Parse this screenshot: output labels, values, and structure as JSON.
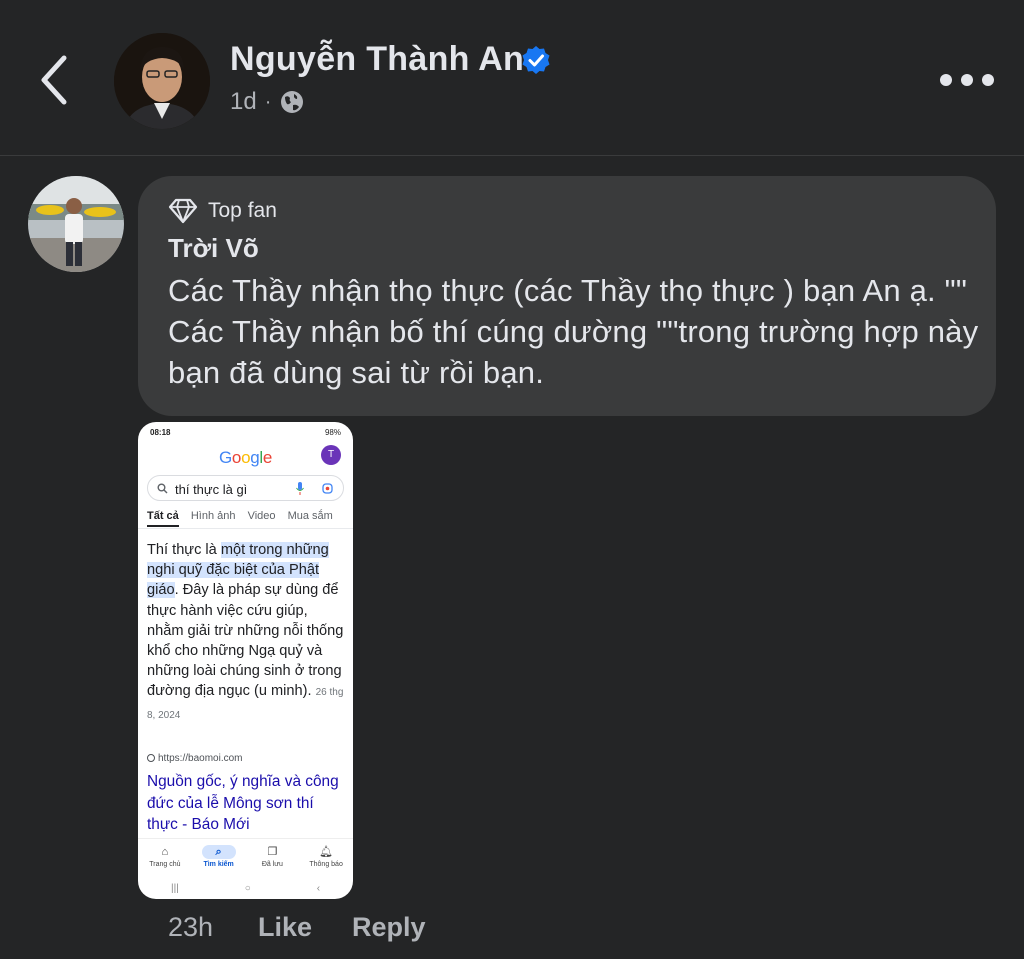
{
  "header": {
    "author_name": "Nguyễn Thành An",
    "time": "1d",
    "separator": "·",
    "verified": true,
    "privacy_icon": "globe-icon",
    "back_icon": "chevron-left-icon",
    "more_icon": "more-horizontal-icon"
  },
  "comment": {
    "badge_icon": "diamond-icon",
    "badge_label": "Top fan",
    "commenter_name": "Trời Võ",
    "text": "Các Thầy nhận thọ thực (các Thầy thọ thực ) bạn An ạ. \"\" Các Thầy nhận bố thí cúng dường \"\"trong trường hợp này bạn đã dùng sai từ rồi bạn.",
    "time": "23h",
    "like_label": "Like",
    "reply_label": "Reply"
  },
  "attachment": {
    "status_time": "08:18",
    "status_battery": "98%",
    "logo": "Google",
    "profile_initial": "T",
    "search_query": "thí thực là gì",
    "tabs": [
      "Tất cả",
      "Hình ảnh",
      "Video",
      "Mua sắm"
    ],
    "snippet_pre": "Thí thực là ",
    "snippet_highlight": "một trong những nghi quỹ đặc biệt của Phật giáo",
    "snippet_post": ". Đây là pháp sự dùng để thực hành việc cứu giúp, nhằm giải trừ những nỗi thống khổ cho những Ngạ quỷ và những loài chúng sinh ở trong đường địa ngục (u minh).",
    "snippet_date": "26 thg 8, 2024",
    "source_url": "https://baomoi.com",
    "result_title": "Nguồn gốc, ý nghĩa và công đức của lễ Mông sơn thí thực - Báo Mới",
    "nav": [
      {
        "label": "Trang chủ",
        "icon": "home-icon"
      },
      {
        "label": "Tìm kiếm",
        "icon": "search-icon"
      },
      {
        "label": "Đã lưu",
        "icon": "bookmark-icon"
      },
      {
        "label": "Thông báo",
        "icon": "bell-icon"
      }
    ]
  },
  "colors": {
    "background": "#242526",
    "bubble": "#3a3b3c",
    "verified": "#1877f2",
    "text_primary": "#e4e6eb",
    "text_secondary": "#b0b3b8"
  }
}
